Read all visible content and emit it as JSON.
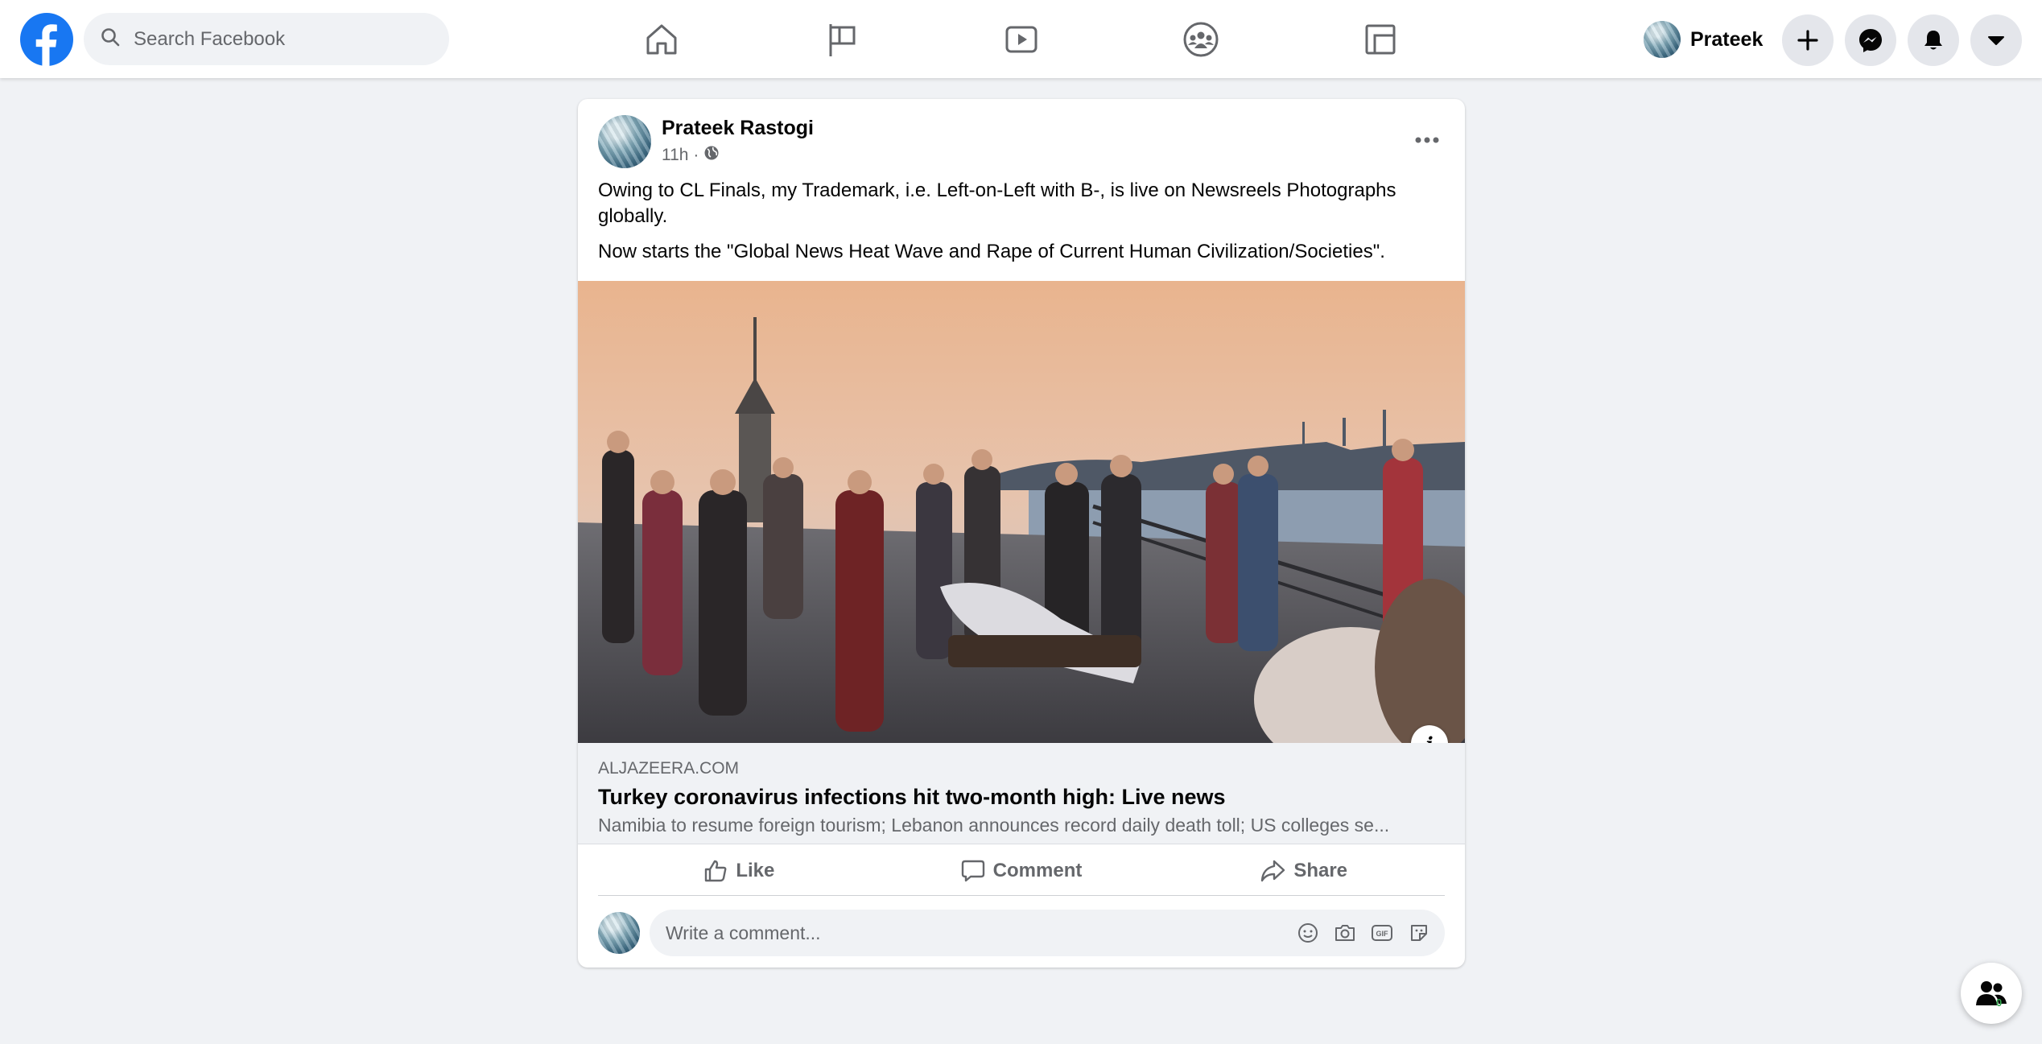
{
  "topbar": {
    "search_placeholder": "Search Facebook",
    "nav": [
      {
        "name": "home",
        "icon": "home-icon"
      },
      {
        "name": "pages",
        "icon": "flag-icon"
      },
      {
        "name": "watch",
        "icon": "video-icon"
      },
      {
        "name": "groups",
        "icon": "groups-icon"
      },
      {
        "name": "gaming",
        "icon": "gaming-icon"
      }
    ],
    "profile_name": "Prateek",
    "buttons": [
      "plus-icon",
      "messenger-icon",
      "notifications-icon",
      "account-dropdown-icon"
    ]
  },
  "post": {
    "author": "Prateek Rastogi",
    "time": "11h ·",
    "audience_icon": "globe-icon",
    "text_1": "Owing to CL Finals, my Trademark, i.e. Left-on-Left with B-, is live on Newsreels Photographs globally.",
    "text_2": "Now starts the \"Global News Heat Wave and Rape of Current Human Civilization/Societies\".",
    "link": {
      "domain": "ALJAZEERA.COM",
      "title": "Turkey coronavirus infections hit two-month high: Live news",
      "description": "Namibia to resume foreign tourism; Lebanon announces record daily death toll; US colleges se..."
    },
    "actions": {
      "like": "Like",
      "comment": "Comment",
      "share": "Share"
    },
    "comment_placeholder": "Write a comment..."
  },
  "contacts": {
    "count": "0"
  },
  "colors": {
    "brand": "#1877f2",
    "background": "#f0f2f5",
    "text_secondary": "#65676b"
  }
}
